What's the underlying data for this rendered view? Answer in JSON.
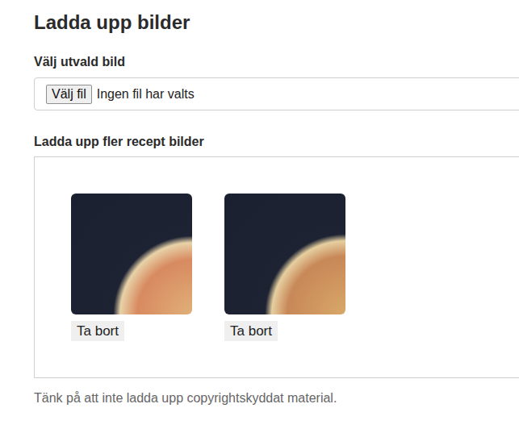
{
  "heading": "Ladda upp bilder",
  "featured": {
    "label": "Välj utvald bild",
    "button": "Välj fil",
    "status": "Ingen fil har valts"
  },
  "gallery": {
    "label": "Ladda upp fler recept bilder",
    "images": [
      {
        "remove": "Ta bort"
      },
      {
        "remove": "Ta bort"
      }
    ]
  },
  "note": "Tänk på att inte ladda upp copyrightskyddat material."
}
